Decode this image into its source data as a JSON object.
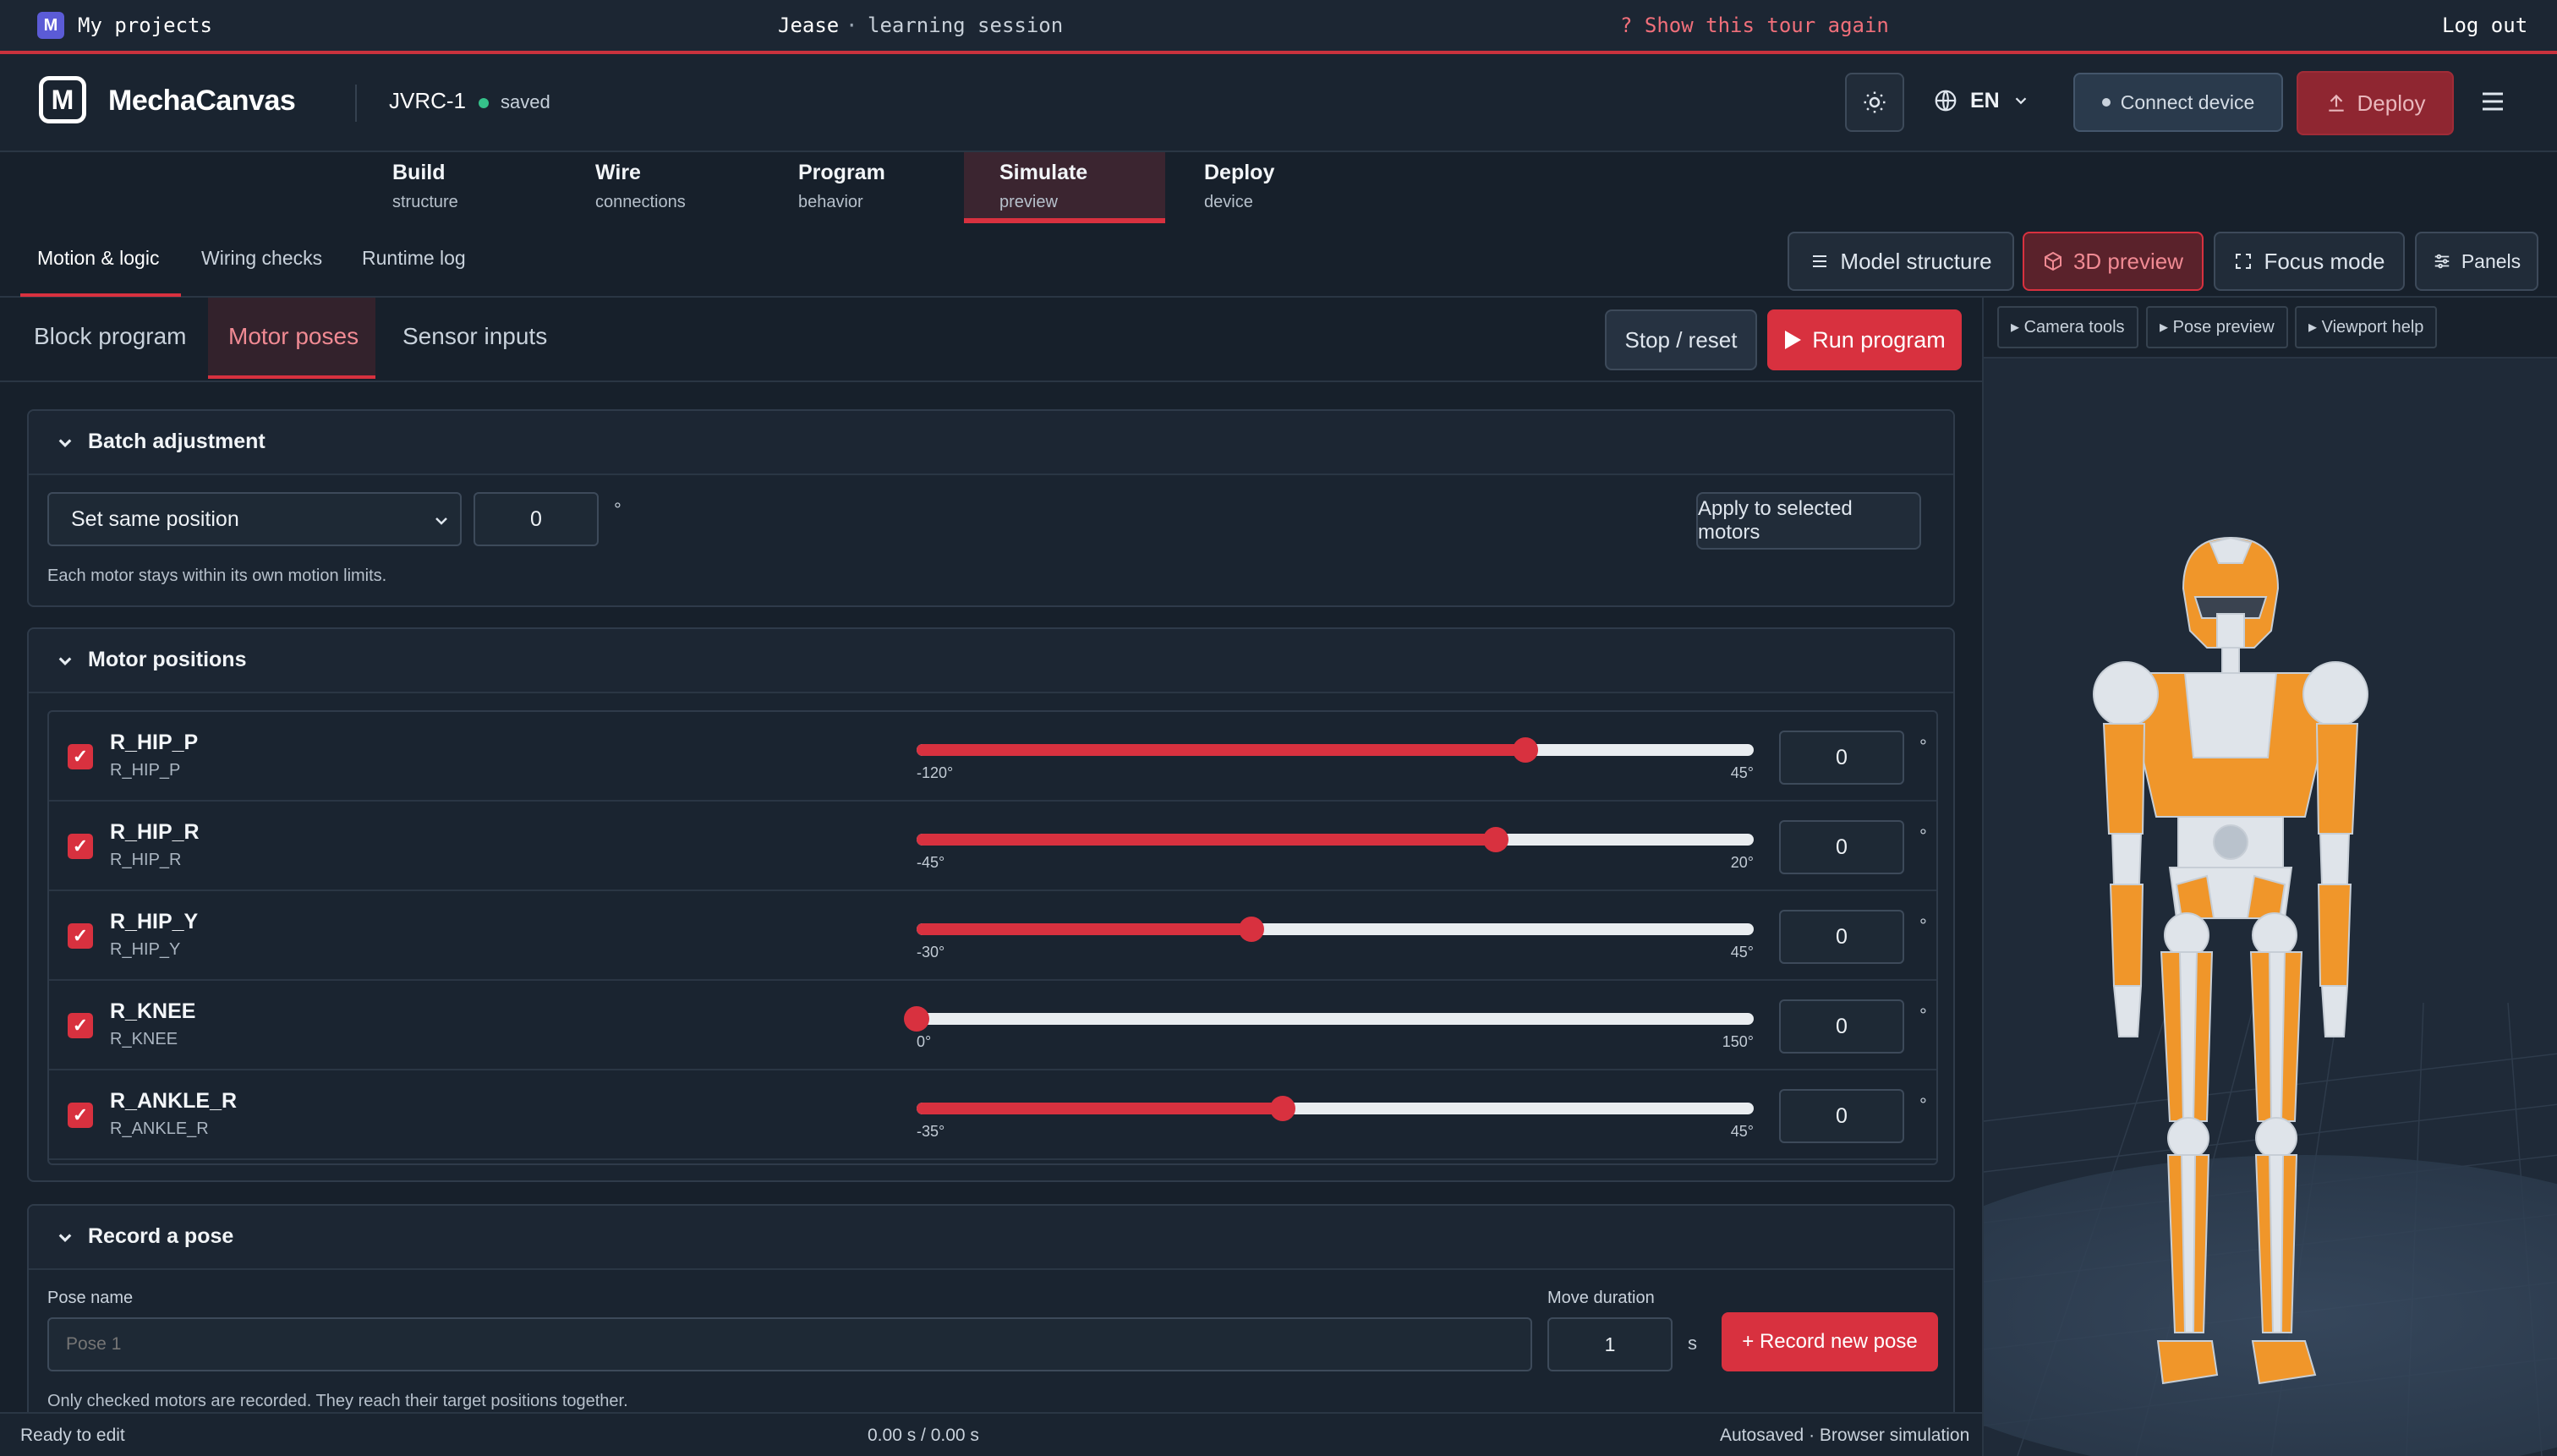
{
  "topstrip": {
    "my_projects": "My projects",
    "user": "Jease",
    "separator": "·",
    "session": "learning session",
    "tour": "? Show this tour again",
    "logout": "Log out"
  },
  "header": {
    "brand": "MechaCanvas",
    "project": "JVRC-1",
    "status": "saved",
    "language": "EN",
    "connect": "Connect device",
    "deploy": "Deploy"
  },
  "stages": [
    {
      "label": "Build",
      "sub": "structure"
    },
    {
      "label": "Wire",
      "sub": "connections"
    },
    {
      "label": "Program",
      "sub": "behavior"
    },
    {
      "label": "Simulate",
      "sub": "preview"
    },
    {
      "label": "Deploy",
      "sub": "device"
    }
  ],
  "subtabs": [
    "Motion & logic",
    "Wiring checks",
    "Runtime log"
  ],
  "view_buttons": {
    "model_structure": "Model structure",
    "preview_3d": "3D preview",
    "focus_mode": "Focus mode",
    "panels": "Panels"
  },
  "panel_tabs": [
    "Block program",
    "Motor poses",
    "Sensor inputs"
  ],
  "run_controls": {
    "stop": "Stop / reset",
    "run": "Run program"
  },
  "batch": {
    "title": "Batch adjustment",
    "mode": "Set same position",
    "value": "0",
    "unit": "°",
    "apply": "Apply to selected motors",
    "hint": "Each motor stays within its own motion limits."
  },
  "motors": {
    "title": "Motor positions",
    "items": [
      {
        "name": "R_HIP_P",
        "id": "R_HIP_P",
        "min": "-120°",
        "max": "45°",
        "value": "0",
        "unit": "°",
        "slider_fraction": 0.727
      },
      {
        "name": "R_HIP_R",
        "id": "R_HIP_R",
        "min": "-45°",
        "max": "20°",
        "value": "0",
        "unit": "°",
        "slider_fraction": 0.692
      },
      {
        "name": "R_HIP_Y",
        "id": "R_HIP_Y",
        "min": "-30°",
        "max": "45°",
        "value": "0",
        "unit": "°",
        "slider_fraction": 0.4
      },
      {
        "name": "R_KNEE",
        "id": "R_KNEE",
        "min": "0°",
        "max": "150°",
        "value": "0",
        "unit": "°",
        "slider_fraction": 0.0
      },
      {
        "name": "R_ANKLE_R",
        "id": "R_ANKLE_R",
        "min": "-35°",
        "max": "45°",
        "value": "0",
        "unit": "°",
        "slider_fraction": 0.4375
      }
    ]
  },
  "record": {
    "title": "Record a pose",
    "pose_label": "Pose name",
    "pose_placeholder": "Pose 1",
    "duration_label": "Move duration",
    "duration_value": "1",
    "duration_unit": "s",
    "button": "+ Record new pose",
    "hint": "Only checked motors are recorded. They reach their target positions together."
  },
  "status": {
    "left": "Ready to edit",
    "center": "0.00 s / 0.00 s",
    "right": "Autosaved · Browser simulation"
  },
  "viewport": {
    "tools": [
      "Camera tools",
      "Pose preview",
      "Viewport help"
    ]
  },
  "colors": {
    "accent": "#d8313f",
    "background": "#17202b",
    "robot_orange": "#f0962a",
    "robot_white": "#dfe4ea"
  }
}
